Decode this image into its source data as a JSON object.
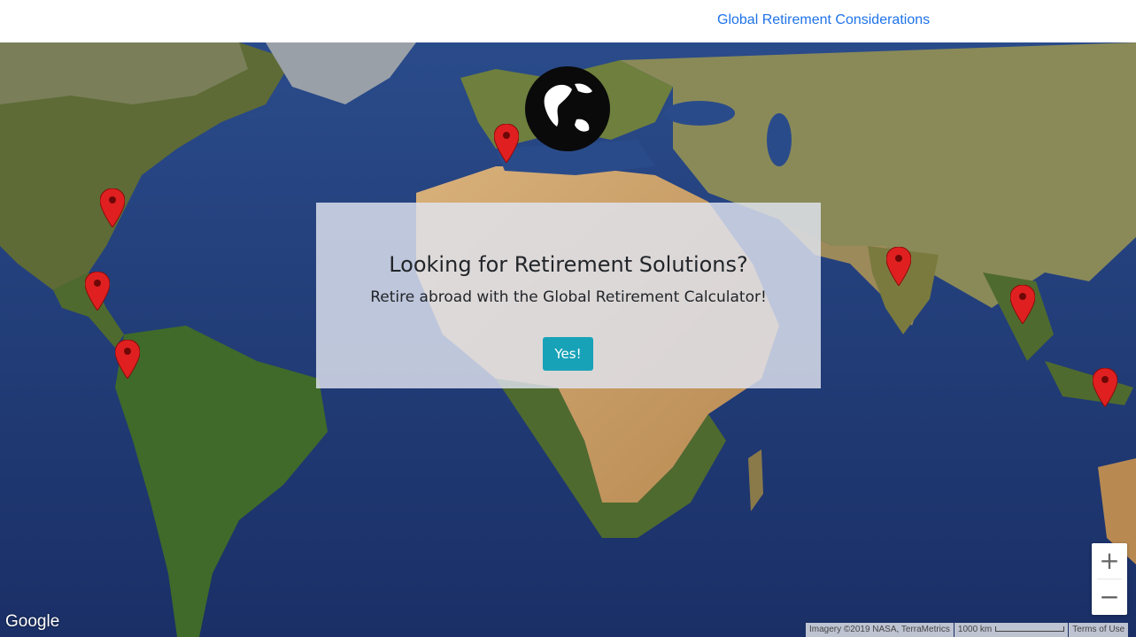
{
  "nav": {
    "link_label": "Global Retirement Considerations"
  },
  "hero": {
    "title": "Looking for Retirement Solutions?",
    "subtitle": "Retire abroad with the Global Retirement Calculator!",
    "button_label": "Yes!"
  },
  "map": {
    "logo_text": "Google",
    "imagery_credit": "Imagery ©2019 NASA, TerraMetrics",
    "scale_label": "1000 km",
    "terms_label": "Terms of Use",
    "zoom_in_label": "+",
    "zoom_out_label": "−",
    "ocean_color": "#1f3a74",
    "land_color": "#6e7a3a",
    "desert_color": "#c9a26b",
    "marker_color": "#e02020",
    "markers_icon": "map-pin-icon"
  }
}
